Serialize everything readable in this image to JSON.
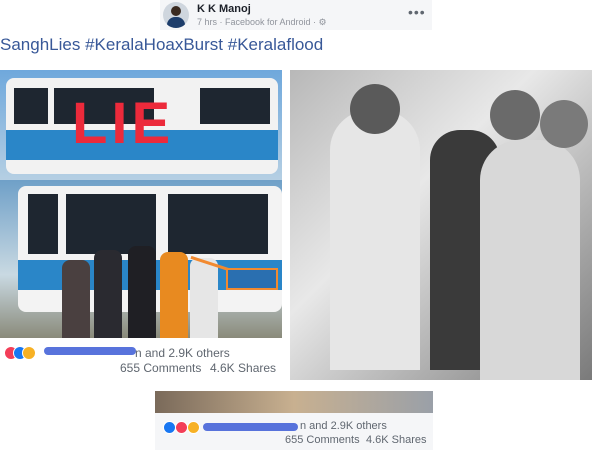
{
  "post": {
    "author": "K K Manoj",
    "meta": "7 hrs · Facebook for Android · ⚙",
    "caption": "SanghLies #KeralaHoaxBurst #Keralaflood",
    "image_text": "LIE"
  },
  "reactions_top": {
    "count_text": "n and 2.9K others",
    "comments": "655 Comments",
    "shares": "4.6K Shares"
  },
  "reactions_bottom": {
    "count_text": "n and 2.9K others",
    "comments": "655 Comments",
    "shares": "4.6K Shares"
  },
  "icons": {
    "more": "more-icon",
    "like": "like-icon",
    "love": "love-icon",
    "haha": "haha-icon"
  },
  "colors": {
    "link": "#385898",
    "lie": "#ec2a3b",
    "bus_blue": "#2a86c8"
  }
}
